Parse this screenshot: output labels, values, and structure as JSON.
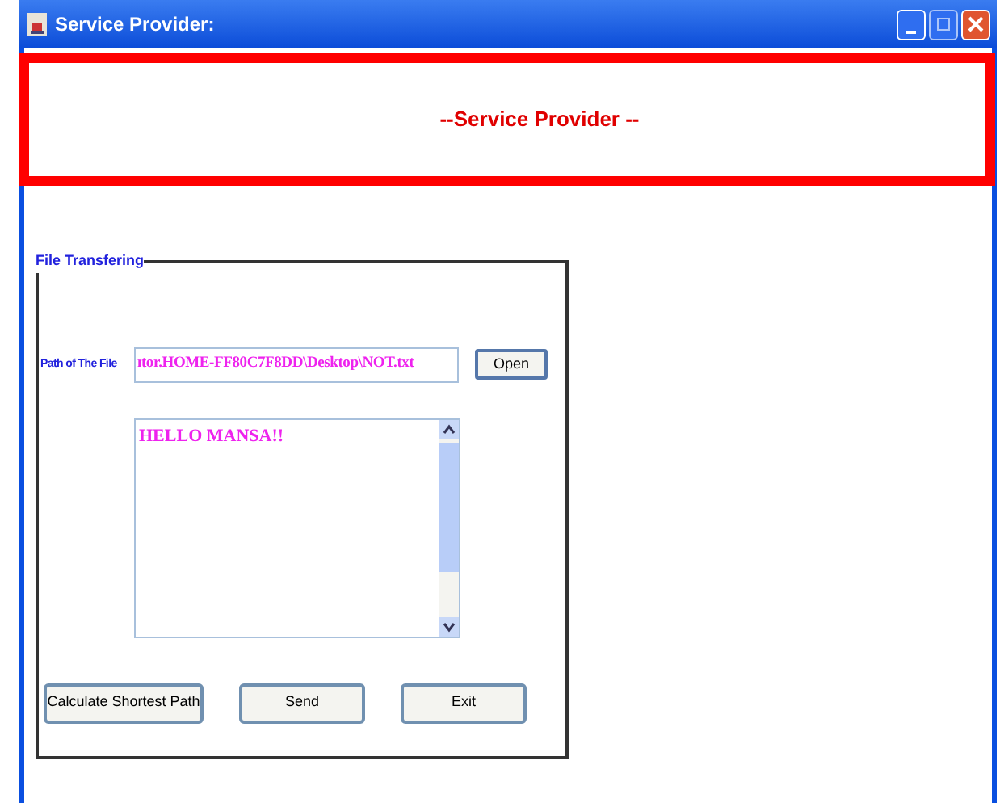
{
  "window": {
    "title": "Service Provider:"
  },
  "banner": {
    "title": "--Service Provider --"
  },
  "group": {
    "title": "File Transfering",
    "path_label": "Path of The File",
    "path_value": "ıtor.HOME-FF80C7F8DD\\Desktop\\NOT.txt",
    "open_button": "Open",
    "message": "HELLO MANSA!!",
    "buttons": [
      "Calculate Shortest Path",
      "Send",
      "Exit"
    ]
  }
}
